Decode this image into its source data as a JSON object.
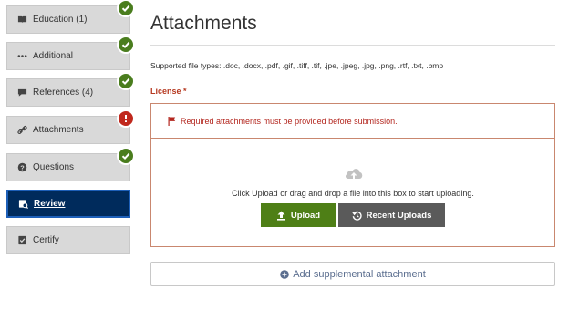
{
  "sidebar": {
    "items": [
      {
        "label": "Education (1)",
        "icon": "book-icon",
        "status": "complete"
      },
      {
        "label": "Additional",
        "icon": "ellipsis-icon",
        "status": "complete"
      },
      {
        "label": "References (4)",
        "icon": "speech-bubble-icon",
        "status": "complete"
      },
      {
        "label": "Attachments",
        "icon": "link-icon",
        "status": "error"
      },
      {
        "label": "Questions",
        "icon": "question-icon",
        "status": "complete"
      },
      {
        "label": "Review",
        "icon": "review-icon",
        "status": "active"
      },
      {
        "label": "Certify",
        "icon": "certify-icon",
        "status": "none"
      }
    ]
  },
  "main": {
    "title": "Attachments",
    "supported_types": "Supported file types: .doc, .docx, .pdf, .gif, .tiff, .tif, .jpe, .jpeg, .jpg, .png, .rtf, .txt, .bmp",
    "license_label": "License *",
    "alert_text": "Required attachments must be provided before submission.",
    "drop_text": "Click Upload or drag and drop a file into this box to start uploading.",
    "upload_label": "Upload",
    "recent_label": "Recent Uploads",
    "supplemental_label": "Add supplemental attachment"
  },
  "colors": {
    "active_nav": "#002b5c",
    "success": "#4a7d1e",
    "error": "#c0281d",
    "upload_button": "#4e7f16",
    "recent_button": "#5a5a5a",
    "license_red": "#b63a22"
  }
}
